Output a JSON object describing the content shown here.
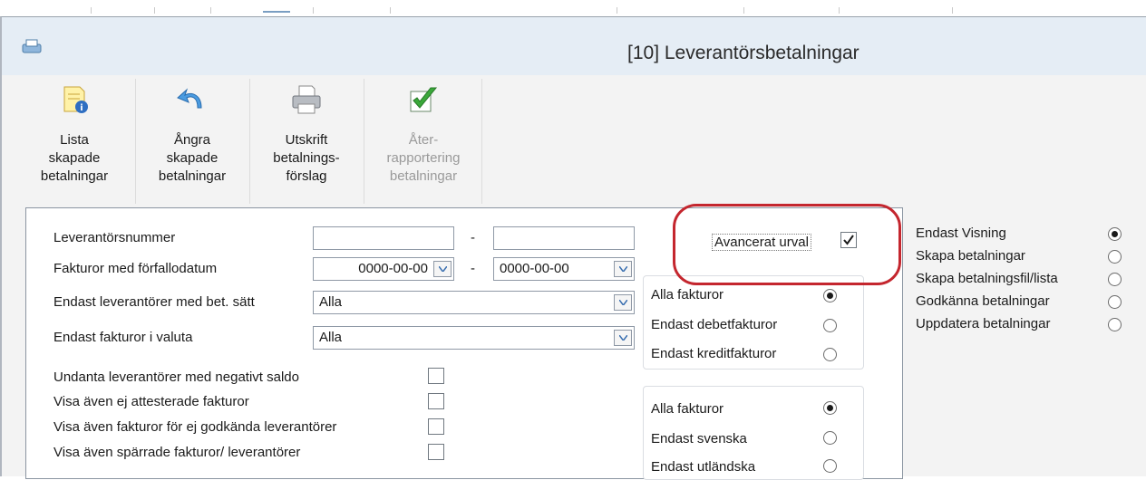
{
  "window": {
    "title": "[10]  Leverantörsbetalningar"
  },
  "toolbar": [
    {
      "name": "lista-skapade-betalningar-button",
      "icon": "list-info-icon",
      "lines": [
        "Lista",
        "skapade",
        "betalningar"
      ],
      "enabled": true
    },
    {
      "name": "angra-skapade-betalningar-button",
      "icon": "undo-arrow-icon",
      "lines": [
        "Ångra",
        "skapade",
        "betalningar"
      ],
      "enabled": true
    },
    {
      "name": "utskrift-betalningsforslag-button",
      "icon": "printer-icon",
      "lines": [
        "Utskrift",
        "betalnings-",
        "förslag"
      ],
      "enabled": true
    },
    {
      "name": "aterrapportering-betalningar-button",
      "icon": "green-check-icon",
      "lines": [
        "Åter-",
        "rapportering",
        "betalningar"
      ],
      "enabled": false
    }
  ],
  "form": {
    "supplier_number_label": "Leverantörsnummer",
    "supplier_from": "",
    "supplier_to": "",
    "range_dash": "-",
    "due_date_label": "Fakturor med förfallodatum",
    "due_date_from": "0000-00-00",
    "due_date_to": "0000-00-00",
    "payment_method_label": "Endast leverantörer med bet. sätt",
    "payment_method_value": "Alla",
    "currency_label": "Endast fakturor i valuta",
    "currency_value": "Alla",
    "advanced_label": "Avancerat urval",
    "advanced_checked": true,
    "checkboxes": [
      {
        "label": "Undanta leverantörer med negativt saldo",
        "checked": false
      },
      {
        "label": "Visa även ej attesterade fakturor",
        "checked": false
      },
      {
        "label": "Visa även fakturor för ej godkända leverantörer",
        "checked": false
      },
      {
        "label": "Visa även spärrade fakturor/ leverantörer",
        "checked": false
      }
    ]
  },
  "invoice_type_group": [
    {
      "label": "Alla fakturor",
      "selected": true
    },
    {
      "label": "Endast debetfakturor",
      "selected": false
    },
    {
      "label": "Endast kreditfakturor",
      "selected": false
    }
  ],
  "origin_group": [
    {
      "label": "Alla fakturor",
      "selected": true
    },
    {
      "label": "Endast svenska",
      "selected": false
    },
    {
      "label": "Endast utländska",
      "selected": false
    }
  ],
  "mode_group": [
    {
      "label": "Endast Visning",
      "selected": true
    },
    {
      "label": "Skapa betalningar",
      "selected": false
    },
    {
      "label": "Skapa betalningsfil/lista",
      "selected": false
    },
    {
      "label": "Godkänna betalningar",
      "selected": false
    },
    {
      "label": "Uppdatera betalningar",
      "selected": false
    }
  ],
  "colors": {
    "titlebar": "#e5edf5",
    "highlight": "#c4262e",
    "panel_border": "#8b95a1"
  }
}
